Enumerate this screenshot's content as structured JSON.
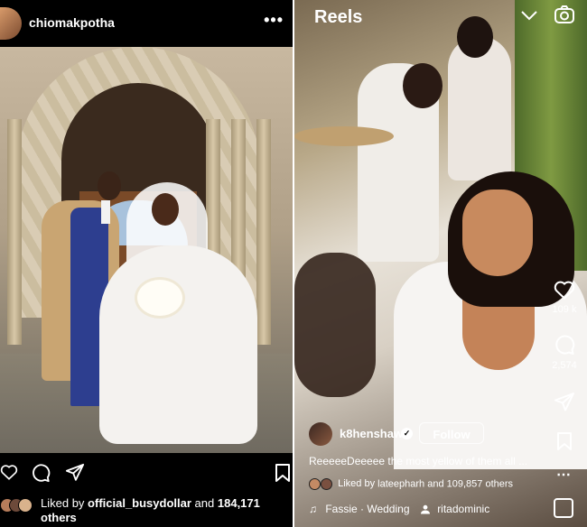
{
  "post": {
    "username": "chiomakpotha",
    "more_label": "•••",
    "tag_icon": "user-icon",
    "actions": [
      "heart-icon",
      "comment-icon",
      "share-icon",
      "save-icon"
    ],
    "liked_by_prefix": "Liked by",
    "liked_by_user": "official_busydollar",
    "liked_by_and": "and",
    "liked_by_count": "184,171",
    "liked_by_suffix": "others"
  },
  "reels": {
    "title": "Reels",
    "side": {
      "like_count": "109 k",
      "comment_count": "2,574"
    },
    "author": {
      "username": "k8henshaw",
      "verified_mark": "✓",
      "follow_label": "Follow"
    },
    "caption": "ReeeeeDeeeee the most yellow of them all ...",
    "liked_by_prefix": "Liked by",
    "liked_by_user": "lateepharh",
    "liked_by_rest": "and 109,857 others",
    "audio": {
      "note": "♫",
      "track": "Fassie · Wedding",
      "tagged": "ritadominic"
    },
    "more_label": "⋯"
  },
  "colors": {
    "background": "#000000",
    "text": "#ffffff",
    "suit_blue": "#2d3e8f",
    "coat_camel": "#c9a572"
  }
}
